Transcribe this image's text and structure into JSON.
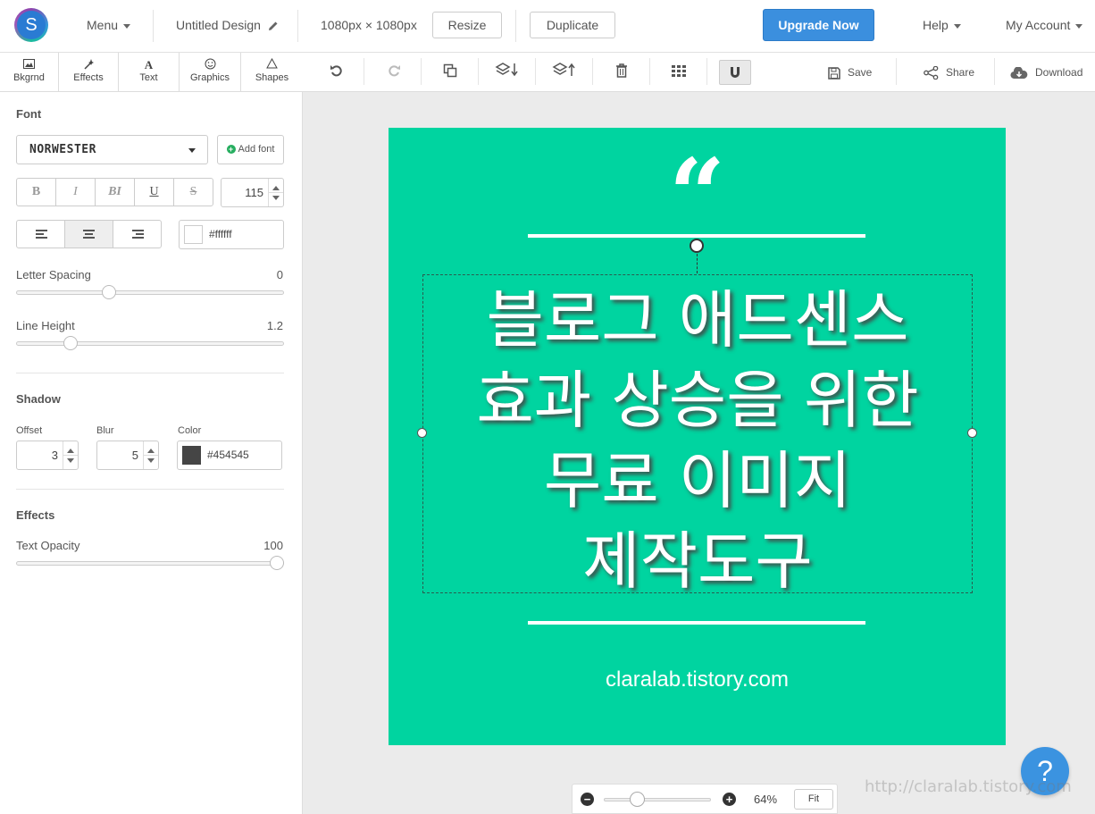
{
  "topbar": {
    "logo_letter": "S",
    "menu_label": "Menu",
    "design_title": "Untitled Design",
    "dimensions": "1080px × 1080px",
    "resize_label": "Resize",
    "duplicate_label": "Duplicate",
    "upgrade_label": "Upgrade Now",
    "help_label": "Help",
    "account_label": "My Account"
  },
  "tabs": [
    {
      "label": "Bkgrnd",
      "icon": "image-icon"
    },
    {
      "label": "Effects",
      "icon": "wand-icon"
    },
    {
      "label": "Text",
      "icon": "text-icon"
    },
    {
      "label": "Graphics",
      "icon": "smiley-icon"
    },
    {
      "label": "Shapes",
      "icon": "triangle-icon"
    }
  ],
  "toolbar": {
    "save_label": "Save",
    "share_label": "Share",
    "download_label": "Download"
  },
  "panel": {
    "font_title": "Font",
    "font_value": "NORWESTER",
    "add_font_label": "Add font",
    "format_buttons": [
      "B",
      "I",
      "BI",
      "U",
      "S"
    ],
    "font_size": "115",
    "text_color": "#ffffff",
    "letter_spacing_label": "Letter Spacing",
    "letter_spacing_value": "0",
    "line_height_label": "Line Height",
    "line_height_value": "1.2",
    "shadow_title": "Shadow",
    "offset_label": "Offset",
    "offset_value": "3",
    "blur_label": "Blur",
    "blur_value": "5",
    "color_label": "Color",
    "shadow_color": "#454545",
    "effects_title": "Effects",
    "opacity_label": "Text Opacity",
    "opacity_value": "100"
  },
  "canvas": {
    "background_color": "#00d4a0",
    "quote_mark": "“",
    "headline_lines": [
      "블로그 애드센스",
      "효과 상승을 위한",
      "무료 이미지",
      "제작도구"
    ],
    "domain_text": "claralab.tistory.com"
  },
  "zoom": {
    "minus": "−",
    "plus": "+",
    "percent": "64%",
    "fit_label": "Fit"
  },
  "help_button": "?",
  "watermark": "http://claralab.tistory.com"
}
